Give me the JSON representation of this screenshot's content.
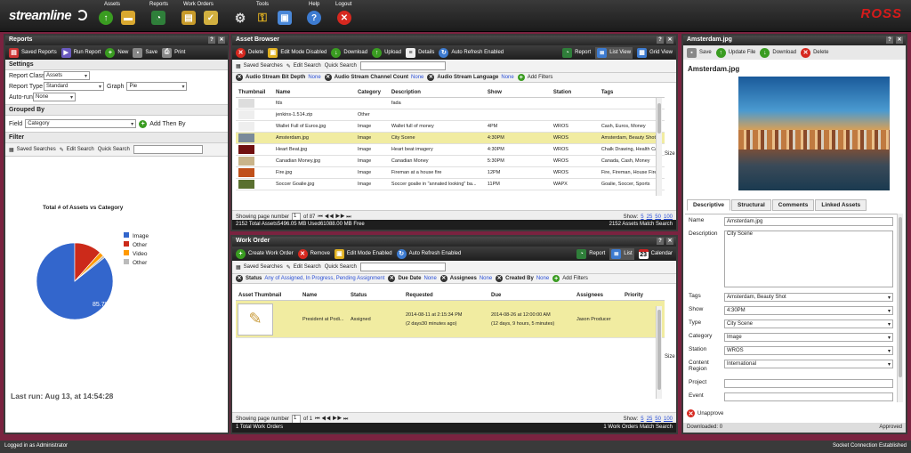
{
  "app": {
    "logo": "streamline",
    "brand": "ROSS",
    "colors": {
      "accent": "#d61b1b",
      "highlight": "#f1eca1",
      "background": "#7a2340"
    }
  },
  "topnav": {
    "groups": [
      {
        "label": "Assets",
        "icons": [
          "upload-icon",
          "folder-icon"
        ]
      },
      {
        "label": "Reports",
        "icons": [
          "report-chart-icon"
        ]
      },
      {
        "label": "Work Orders",
        "icons": [
          "work-orders-icon",
          "checklist-icon"
        ]
      },
      {
        "label": "Tools",
        "icons": [
          "gear-icon",
          "key-icon",
          "windows-icon"
        ]
      },
      {
        "label": "Help",
        "icons": [
          "help-icon"
        ]
      },
      {
        "label": "Logout",
        "icons": [
          "logout-icon"
        ]
      }
    ]
  },
  "reports": {
    "title": "Reports",
    "toolbar": {
      "saved": "Saved Reports",
      "run": "Run Report",
      "new": "New",
      "save": "Save",
      "print": "Print"
    },
    "settings": {
      "heading": "Settings",
      "report_class_label": "Report Class",
      "report_class": "Assets",
      "report_type_label": "Report Type",
      "report_type": "Standard",
      "graph_label": "Graph",
      "graph": "Pie",
      "autorun_label": "Auto-run",
      "autorun": "None"
    },
    "grouped": {
      "heading": "Grouped By",
      "field_label": "Field",
      "field": "Category",
      "add_then": "Add Then By"
    },
    "filter": {
      "heading": "Filter",
      "saved": "Saved Searches",
      "edit": "Edit Search",
      "quick": "Quick Search"
    },
    "last_run": "Last run: Aug 13, at 14:54:28"
  },
  "chart_data": {
    "type": "pie",
    "title": "Total # of Assets vs Category",
    "slices": [
      {
        "name": "Image",
        "value": 85.7,
        "color": "#3366cc"
      },
      {
        "name": "Other",
        "value": 11.5,
        "color": "#cc2a1a"
      },
      {
        "name": "Video",
        "value": 1.9,
        "color": "#ff9900"
      },
      {
        "name": "Other",
        "value": 0.9,
        "color": "#bbbbbb"
      }
    ],
    "data_label": "85.7%",
    "legend": "right"
  },
  "asset_browser": {
    "title": "Asset Browser",
    "toolbar": {
      "delete": "Delete",
      "edit_mode": "Edit Mode Disabled",
      "download": "Download",
      "upload": "Upload",
      "details": "Details",
      "auto_refresh": "Auto Refresh Enabled",
      "report": "Report",
      "list_view": "List View",
      "grid_view": "Grid View"
    },
    "search": {
      "saved": "Saved Searches",
      "edit": "Edit Search",
      "quick": "Quick Search"
    },
    "filters": [
      {
        "name": "Audio Stream Bit Depth",
        "value": "None"
      },
      {
        "name": "Audio Stream Channel Count",
        "value": "None"
      },
      {
        "name": "Audio Stream Language",
        "value": "None"
      }
    ],
    "add_filters": "Add Filters",
    "columns": [
      "Thumbnail",
      "Name",
      "Category",
      "Description",
      "Show",
      "Station",
      "Tags"
    ],
    "rows": [
      {
        "thumb": "#ddd",
        "name": "fds",
        "category": "",
        "description": "fada",
        "show": "",
        "station": "",
        "tags": ""
      },
      {
        "thumb": "#eee",
        "name": "jenkins-1.514.zip",
        "category": "Other",
        "description": "",
        "show": "",
        "station": "",
        "tags": ""
      },
      {
        "thumb": "#eee",
        "name": "Wallet Full of Euros.jpg",
        "category": "Image",
        "description": "Wallet full of money",
        "show": "4PM",
        "station": "WROS",
        "tags": "Cash, Euros, Money"
      },
      {
        "thumb": "#7a8a9a",
        "name": "Amsterdam.jpg",
        "category": "Image",
        "description": "City Scene",
        "show": "4:30PM",
        "station": "WROS",
        "tags": "Amsterdam, Beauty Shot"
      },
      {
        "thumb": "#701010",
        "name": "Heart Beat.jpg",
        "category": "Image",
        "description": "Heart beat imagery",
        "show": "4:30PM",
        "station": "WROS",
        "tags": "Chalk Drawing, Health Care"
      },
      {
        "thumb": "#c9b48a",
        "name": "Canadian Money.jpg",
        "category": "Image",
        "description": "Canadian Money",
        "show": "5:30PM",
        "station": "WROS",
        "tags": "Canada, Cash, Money"
      },
      {
        "thumb": "#c0501a",
        "name": "Fire.jpg",
        "category": "Image",
        "description": "Fireman at a house fire",
        "show": "12PM",
        "station": "WROS",
        "tags": "Fire, Fireman, House Fire"
      },
      {
        "thumb": "#5a7030",
        "name": "Soccer Goalie.jpg",
        "category": "Image",
        "description": "Soccer goalie in \"annated looking\" ba...",
        "show": "11PM",
        "station": "WAPX",
        "tags": "Goalie, Soccer, Sports"
      }
    ],
    "pager": {
      "showing": "Showing page number",
      "page": "1",
      "of": "of 87",
      "show_label": "Show:",
      "sizes": [
        "5",
        "25",
        "50",
        "100"
      ]
    },
    "status": {
      "total": "2152 Total Assets",
      "used": "5496.05 MB Used",
      "free": "61088.00 MB Free",
      "match": "2152 Assets Match Search"
    }
  },
  "work_order": {
    "title": "Work Order",
    "toolbar": {
      "create": "Create Work Order",
      "remove": "Remove",
      "edit_mode": "Edit Mode Enabled",
      "auto_refresh": "Auto Refresh Enabled",
      "report": "Report",
      "list": "List",
      "calendar": "Calendar",
      "calendar_day": "23"
    },
    "search": {
      "saved": "Saved Searches",
      "edit": "Edit Search",
      "quick": "Quick Search"
    },
    "filters": [
      {
        "name": "Status",
        "value": "Any of Assigned, In Progress, Pending Assignment"
      },
      {
        "name": "Due Date",
        "value": "None"
      },
      {
        "name": "Assignees",
        "value": "None"
      },
      {
        "name": "Created By",
        "value": "None"
      }
    ],
    "add_filters": "Add Filters",
    "columns": [
      "Asset Thumbnail",
      "Name",
      "Status",
      "Requested",
      "Due",
      "Assignees",
      "Priority"
    ],
    "rows": [
      {
        "name": "President at Podi...",
        "status": "Assigned",
        "requested": "2014-08-11 at 2:15:34 PM",
        "requested_sub": "(2 days30 minutes ago)",
        "due": "2014-08-26 at 12:00:00 AM",
        "due_sub": "(12 days, 9 hours, 5 minutes)",
        "assignees": "Jason Producer",
        "priority": ""
      }
    ],
    "pager": {
      "showing": "Showing page number",
      "page": "1",
      "of": "of 1",
      "show_label": "Show:",
      "sizes": [
        "5",
        "25",
        "50",
        "100"
      ]
    },
    "status": {
      "total": "1 Total Work Orders",
      "match": "1 Work Orders Match Search"
    }
  },
  "detail": {
    "title": "Amsterdam.jpg",
    "toolbar": {
      "save": "Save",
      "update": "Update File",
      "download": "Download",
      "delete": "Delete"
    },
    "filename": "Amsterdam.jpg",
    "tabs": [
      "Descriptive",
      "Structural",
      "Comments",
      "Linked Assets"
    ],
    "fields": {
      "name_label": "Name",
      "name": "Amsterdam.jpg",
      "description_label": "Description",
      "description": "City Scene",
      "tags_label": "Tags",
      "tags": "Amsterdam, Beauty Shot",
      "show_label": "Show",
      "show": "4:30PM",
      "type_label": "Type",
      "type": "City Scene",
      "category_label": "Category",
      "category": "Image",
      "station_label": "Station",
      "station": "WROS",
      "content_region_label": "Content Region",
      "content_region": "International",
      "project_label": "Project",
      "project": "",
      "event_label": "Event",
      "event": ""
    },
    "unapprove": "Unapprove",
    "downloaded": "Downloaded: 0",
    "approved": "Approved"
  },
  "footer": {
    "left": "Logged in as Administrator",
    "right": "Socket Connection Established"
  }
}
